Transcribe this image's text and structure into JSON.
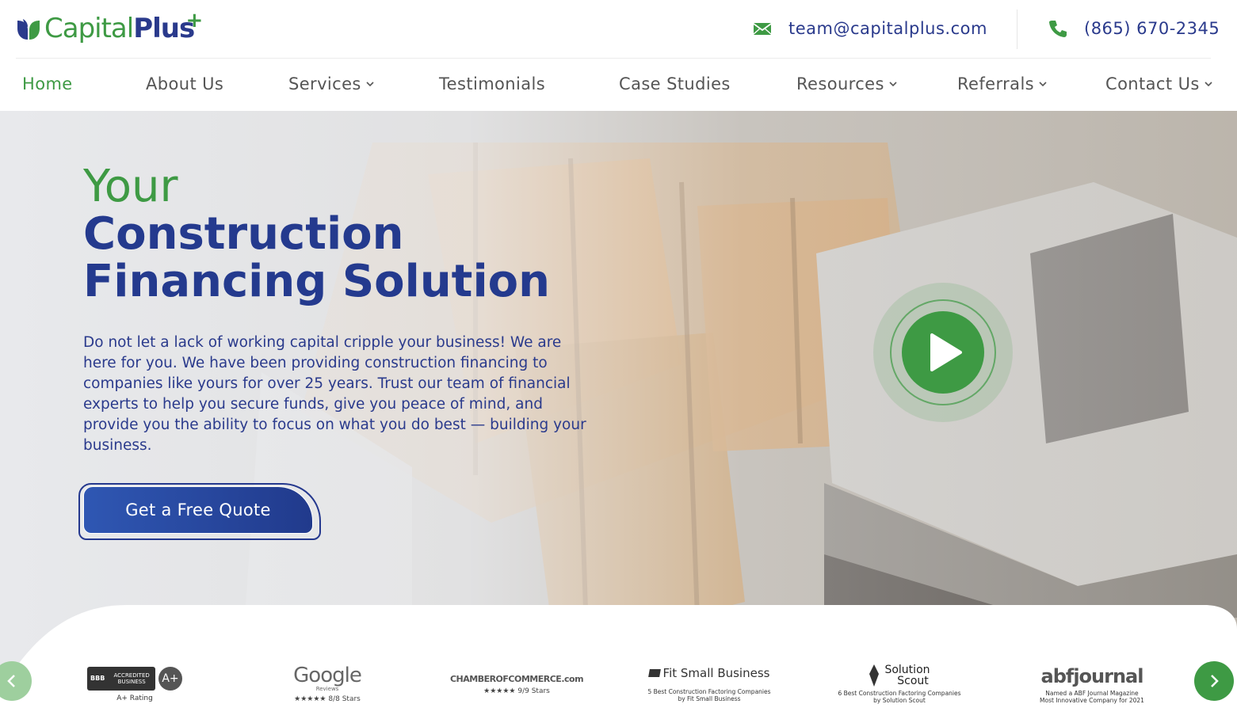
{
  "header": {
    "logo": {
      "word_a": "Capital",
      "word_b": "Plus",
      "superscript": "+"
    },
    "email": "team@capitalplus.com",
    "phone": "(865) 670-2345"
  },
  "nav": {
    "items": [
      {
        "label": "Home",
        "active": true,
        "has_dropdown": false
      },
      {
        "label": "About Us",
        "active": false,
        "has_dropdown": false
      },
      {
        "label": "Services",
        "active": false,
        "has_dropdown": true
      },
      {
        "label": "Testimonials",
        "active": false,
        "has_dropdown": false
      },
      {
        "label": "Case Studies",
        "active": false,
        "has_dropdown": false
      },
      {
        "label": "Resources",
        "active": false,
        "has_dropdown": true
      },
      {
        "label": "Referrals",
        "active": false,
        "has_dropdown": true
      },
      {
        "label": "Contact Us",
        "active": false,
        "has_dropdown": true
      }
    ]
  },
  "hero": {
    "title_line1": "Your",
    "title_line2": "Construction",
    "title_line3": "Financing Solution",
    "description": "Do not let a lack of working capital cripple your business! We are here for you. We have been providing construction financing to companies like yours for over 25 years. Trust our team of financial experts to help you secure funds, give you peace of mind, and provide you the ability to focus on what you do best — building your business.",
    "cta_label": "Get a Free Quote"
  },
  "trust_badges": {
    "bbb": {
      "box_text": "ACCREDITED BUSINESS",
      "mark": "BBB",
      "grade": "A+",
      "caption": "A+ Rating"
    },
    "google": {
      "word": "Google",
      "sub": "Reviews",
      "stars": "★★★★★",
      "rating": "8/8 Stars"
    },
    "chamber": {
      "name": "CHAMBEROFCOMMERCE.com",
      "stars": "★★★★★",
      "rating": "9/9 Stars"
    },
    "fsb": {
      "name": "Fit Small Business",
      "caption_1": "5 Best Construction Factoring Companies",
      "caption_2": "by Fit Small Business"
    },
    "scout": {
      "name_1": "Solution",
      "name_2": "Scout",
      "caption_1": "6 Best Construction Factoring Companies",
      "caption_2": "by Solution Scout"
    },
    "abf": {
      "name": "abfjournal",
      "caption_1": "Named a ABF Journal Magazine",
      "caption_2": "Most Innovative Company for 2021"
    }
  },
  "colors": {
    "brand_green": "#3e9a44",
    "brand_navy": "#243a8e",
    "cta_gradient_start": "#2f57b3"
  },
  "icons": {
    "email": "envelope-icon",
    "phone": "phone-icon",
    "play": "play-icon",
    "prev": "chevron-left-icon",
    "next": "chevron-right-icon",
    "dropdown": "chevron-down-icon"
  }
}
